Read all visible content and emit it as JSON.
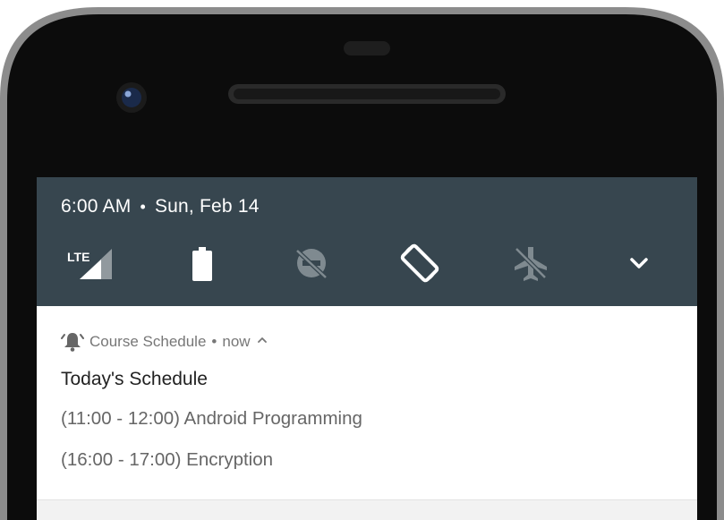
{
  "status_header": {
    "time": "6:00 AM",
    "separator": "•",
    "date": "Sun, Feb 14"
  },
  "quick_settings": [
    {
      "icon": "lte-signal-icon",
      "label": "LTE"
    },
    {
      "icon": "battery-icon"
    },
    {
      "icon": "do-not-disturb-icon"
    },
    {
      "icon": "auto-rotate-icon"
    },
    {
      "icon": "airplane-mode-icon"
    },
    {
      "icon": "expand-chevron-icon"
    }
  ],
  "notification": {
    "app_icon": "alarm-bell-icon",
    "app_name": "Course Schedule",
    "separator": "•",
    "time": "now",
    "title": "Today's Schedule",
    "lines": [
      "(11:00 - 12:00) Android Programming",
      "(16:00 - 17:00) Encryption"
    ]
  },
  "colors": {
    "panel": "#37464f",
    "frame": "#111111",
    "notification_bg": "#ffffff",
    "secondary_text": "#666666"
  }
}
